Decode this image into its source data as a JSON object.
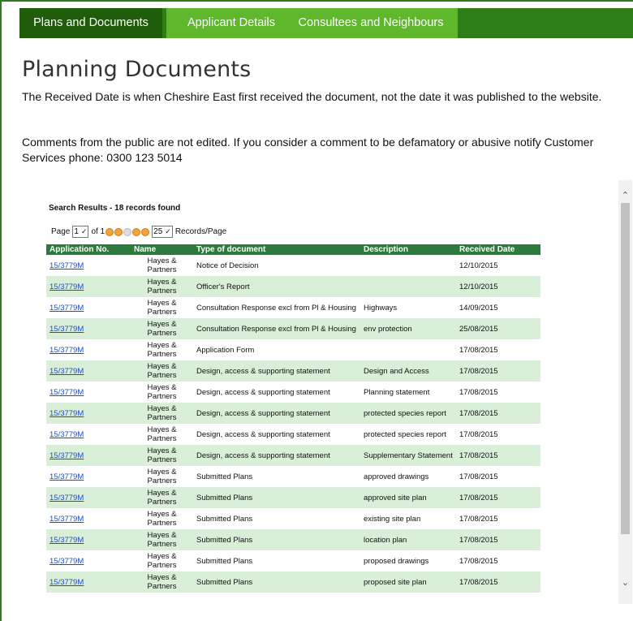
{
  "tabs": [
    {
      "label": "Plans and Documents"
    },
    {
      "label": "Applicant Details"
    },
    {
      "label": "Consultees and Neighbours"
    }
  ],
  "page": {
    "title": "Planning Documents",
    "para1": "The Received Date is when Cheshire East first received the document, not the date it was published to the website.",
    "para2": "Comments from the public are not edited. If you consider a comment to be defamatory or abusive notify Customer Services phone: 0300 123 5014"
  },
  "results": {
    "title": "Search Results - 18 records found",
    "page_label": "Page",
    "page_value": "1",
    "of_label": "of 1",
    "per_page_value": "25",
    "per_page_label": "Records/Page"
  },
  "table": {
    "headers": [
      "Application No.",
      "Name",
      "Type of document",
      "Description",
      "Received Date"
    ],
    "rows": [
      {
        "app": "15/3779M",
        "name": "Hayes & Partners",
        "type": "Notice of Decision",
        "desc": "",
        "date": "12/10/2015"
      },
      {
        "app": "15/3779M",
        "name": "Hayes & Partners",
        "type": "Officer's Report",
        "desc": "",
        "date": "12/10/2015"
      },
      {
        "app": "15/3779M",
        "name": "Hayes & Partners",
        "type": "Consultation Response excl from Pl & Housing",
        "desc": "Highways",
        "date": "14/09/2015"
      },
      {
        "app": "15/3779M",
        "name": "Hayes & Partners",
        "type": "Consultation Response excl from Pl & Housing",
        "desc": "env protection",
        "date": "25/08/2015"
      },
      {
        "app": "15/3779M",
        "name": "Hayes & Partners",
        "type": "Application Form",
        "desc": "",
        "date": "17/08/2015"
      },
      {
        "app": "15/3779M",
        "name": "Hayes & Partners",
        "type": "Design, access & supporting statement",
        "desc": "Design and Access",
        "date": "17/08/2015"
      },
      {
        "app": "15/3779M",
        "name": "Hayes & Partners",
        "type": "Design, access & supporting statement",
        "desc": "Planning statement",
        "date": "17/08/2015"
      },
      {
        "app": "15/3779M",
        "name": "Hayes & Partners",
        "type": "Design, access & supporting statement",
        "desc": "protected species report",
        "date": "17/08/2015"
      },
      {
        "app": "15/3779M",
        "name": "Hayes & Partners",
        "type": "Design, access & supporting statement",
        "desc": "protected species report",
        "date": "17/08/2015"
      },
      {
        "app": "15/3779M",
        "name": "Hayes & Partners",
        "type": "Design, access & supporting statement",
        "desc": "Supplementary Statement",
        "date": "17/08/2015"
      },
      {
        "app": "15/3779M",
        "name": "Hayes & Partners",
        "type": "Submitted Plans",
        "desc": "approved drawings",
        "date": "17/08/2015"
      },
      {
        "app": "15/3779M",
        "name": "Hayes & Partners",
        "type": "Submitted Plans",
        "desc": "approved site plan",
        "date": "17/08/2015"
      },
      {
        "app": "15/3779M",
        "name": "Hayes & Partners",
        "type": "Submitted Plans",
        "desc": "existing site plan",
        "date": "17/08/2015"
      },
      {
        "app": "15/3779M",
        "name": "Hayes & Partners",
        "type": "Submitted Plans",
        "desc": "location plan",
        "date": "17/08/2015"
      },
      {
        "app": "15/3779M",
        "name": "Hayes & Partners",
        "type": "Submitted Plans",
        "desc": "proposed drawings",
        "date": "17/08/2015"
      },
      {
        "app": "15/3779M",
        "name": "Hayes & Partners",
        "type": "Submitted Plans",
        "desc": "proposed site plan",
        "date": "17/08/2015"
      }
    ]
  }
}
